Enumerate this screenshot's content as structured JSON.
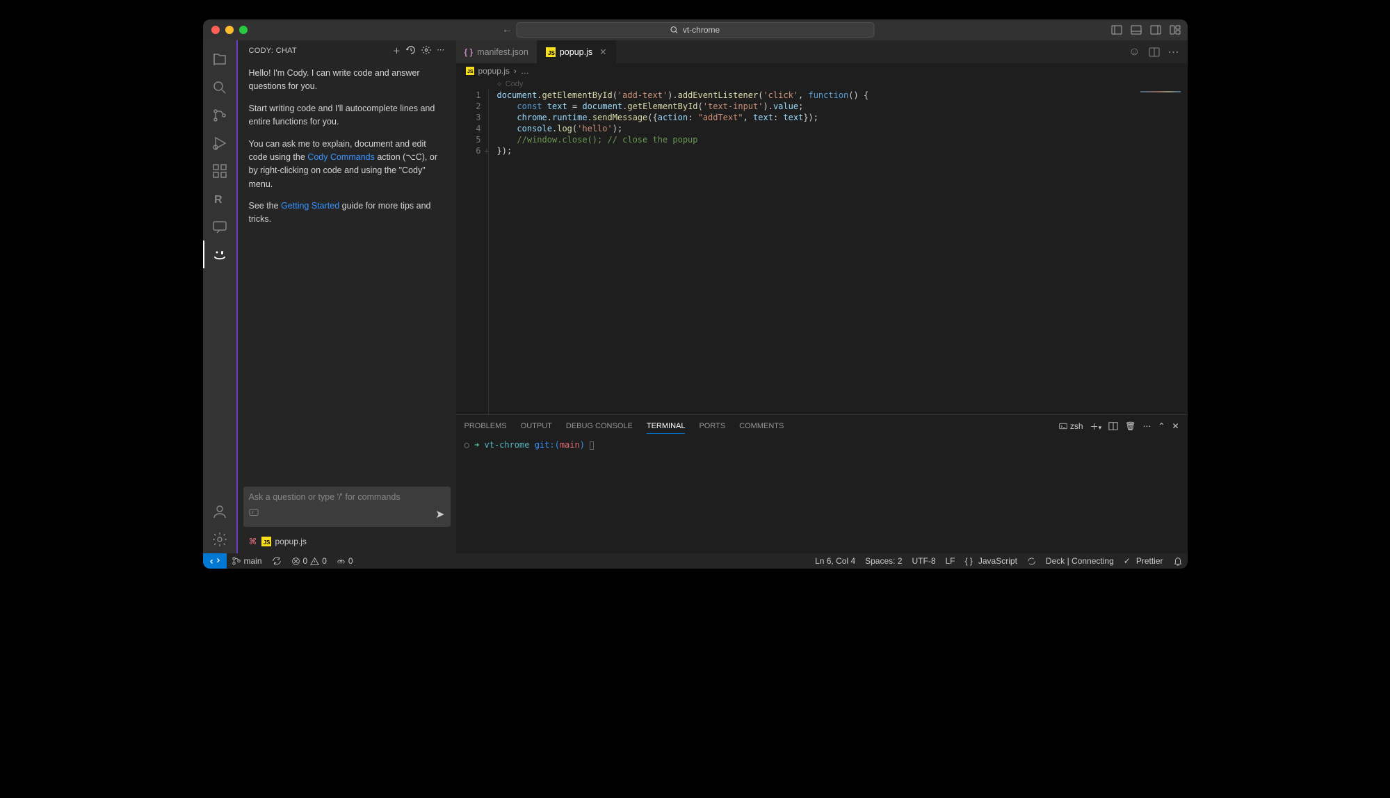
{
  "titlebar": {
    "search": "vt-chrome"
  },
  "sidebar": {
    "title": "CODY: CHAT",
    "p1": "Hello! I'm Cody. I can write code and answer questions for you.",
    "p2": "Start writing code and I'll autocomplete lines and entire functions for you.",
    "p3a": "You can ask me to explain, document and edit code using the ",
    "p3link": "Cody Commands",
    "p3b": " action (⌥C), or by right-clicking on code and using the \"Cody\" menu.",
    "p4a": "See the ",
    "p4link": "Getting Started",
    "p4b": " guide for more tips and tricks.",
    "placeholder": "Ask a question or type '/' for commands",
    "context_file": "popup.js"
  },
  "tabs": [
    {
      "label": "manifest.json",
      "active": false,
      "kind": "json"
    },
    {
      "label": "popup.js",
      "active": true,
      "kind": "js"
    }
  ],
  "breadcrumb": {
    "file": "popup.js",
    "rest": "…"
  },
  "ghost": "Cody",
  "code": {
    "lines": [
      1,
      2,
      3,
      4,
      5,
      6
    ],
    "l1": {
      "a": "document",
      "b": ".",
      "c": "getElementById",
      "d": "(",
      "e": "'add-text'",
      "f": ").",
      "g": "addEventListener",
      "h": "(",
      "i": "'click'",
      "j": ", ",
      "k": "function",
      "l": "() {"
    },
    "l2": {
      "indent": "    ",
      "a": "const",
      "b": " ",
      "c": "text",
      "d": " = ",
      "e": "document",
      "f": ".",
      "g": "getElementById",
      "h": "(",
      "i": "'text-input'",
      "j": ").",
      "k": "value",
      "l": ";"
    },
    "l3": {
      "indent": "    ",
      "a": "chrome",
      "b": ".",
      "c": "runtime",
      "d": ".",
      "e": "sendMessage",
      "f": "({",
      "g": "action",
      "h": ": ",
      "i": "\"addText\"",
      "j": ", ",
      "k": "text",
      "l": ": ",
      "m": "text",
      "n": "});"
    },
    "l4": {
      "indent": "    ",
      "a": "console",
      "b": ".",
      "c": "log",
      "d": "(",
      "e": "'hello'",
      "f": ");"
    },
    "l5": {
      "indent": "    ",
      "a": "//window.close(); // close the popup"
    },
    "l6": {
      "a": "});"
    }
  },
  "panel": {
    "tabs": [
      "PROBLEMS",
      "OUTPUT",
      "DEBUG CONSOLE",
      "TERMINAL",
      "PORTS",
      "COMMENTS"
    ],
    "active": 3,
    "shell": "zsh",
    "prompt": {
      "symbol": "➜",
      "repo": "vt-chrome",
      "git": "git:(",
      "branch": "main",
      "gitend": ")"
    }
  },
  "status": {
    "branch": "main",
    "sync": "",
    "errors": "0",
    "warnings": "0",
    "ports": "0",
    "ln": "Ln 6, Col 4",
    "spaces": "Spaces: 2",
    "encoding": "UTF-8",
    "eol": "LF",
    "lang": "JavaScript",
    "deck": "Deck | Connecting",
    "prettier": "Prettier"
  }
}
